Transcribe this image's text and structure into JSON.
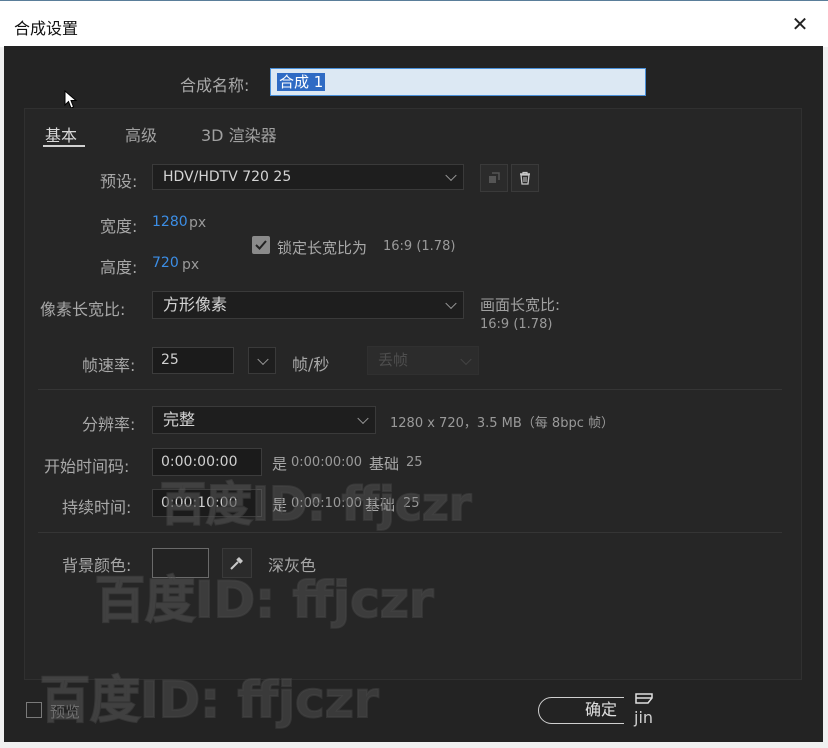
{
  "window": {
    "title": "合成设置"
  },
  "comp_name": {
    "label": "合成名称:",
    "value": "合成 1"
  },
  "tabs": [
    {
      "label": "基本"
    },
    {
      "label": "高级"
    },
    {
      "label": "3D 渲染器"
    }
  ],
  "preset": {
    "label": "预设:",
    "value": "HDV/HDTV 720 25"
  },
  "width": {
    "label": "宽度:",
    "value": "1280",
    "unit": "px"
  },
  "height": {
    "label": "高度:",
    "value": "720",
    "unit": "px"
  },
  "lock_aspect": {
    "label": "锁定长宽比为",
    "ratio": "16:9 (1.78)",
    "checked": true
  },
  "pixel_aspect": {
    "label": "像素长宽比:",
    "value": "方形像素"
  },
  "frame_aspect": {
    "label": "画面长宽比:",
    "value": "16:9 (1.78)"
  },
  "frame_rate": {
    "label": "帧速率:",
    "value": "25",
    "unit": "帧/秒",
    "drop_frame": "丢帧"
  },
  "resolution": {
    "label": "分辨率:",
    "value": "完整",
    "info": "1280 x 720，3.5 MB（每 8bpc 帧）"
  },
  "start_timecode": {
    "label": "开始时间码:",
    "value": "0:00:00:00",
    "is_label": "是",
    "is_value": "0:00:00:00",
    "base_label": "基础",
    "base_value": "25"
  },
  "duration": {
    "label": "持续时间:",
    "value": "0:00:10:00",
    "is_label": "是",
    "is_value": "0:00:10:00",
    "base_label": "基础",
    "base_value": "25"
  },
  "background": {
    "label": "背景颜色:",
    "color_name": "深灰色",
    "swatch": "#232323"
  },
  "preview": {
    "label": "预览"
  },
  "ok_button": {
    "label": "确定"
  },
  "watermark": {
    "text": "百度ID: ffjczr"
  },
  "corner_text": "jin",
  "colors": {
    "dialog_bg": "#232323",
    "accent_blue": "#3c8ee6",
    "name_field_bg": "#dce8f3",
    "selection": "#2f6bc4"
  }
}
